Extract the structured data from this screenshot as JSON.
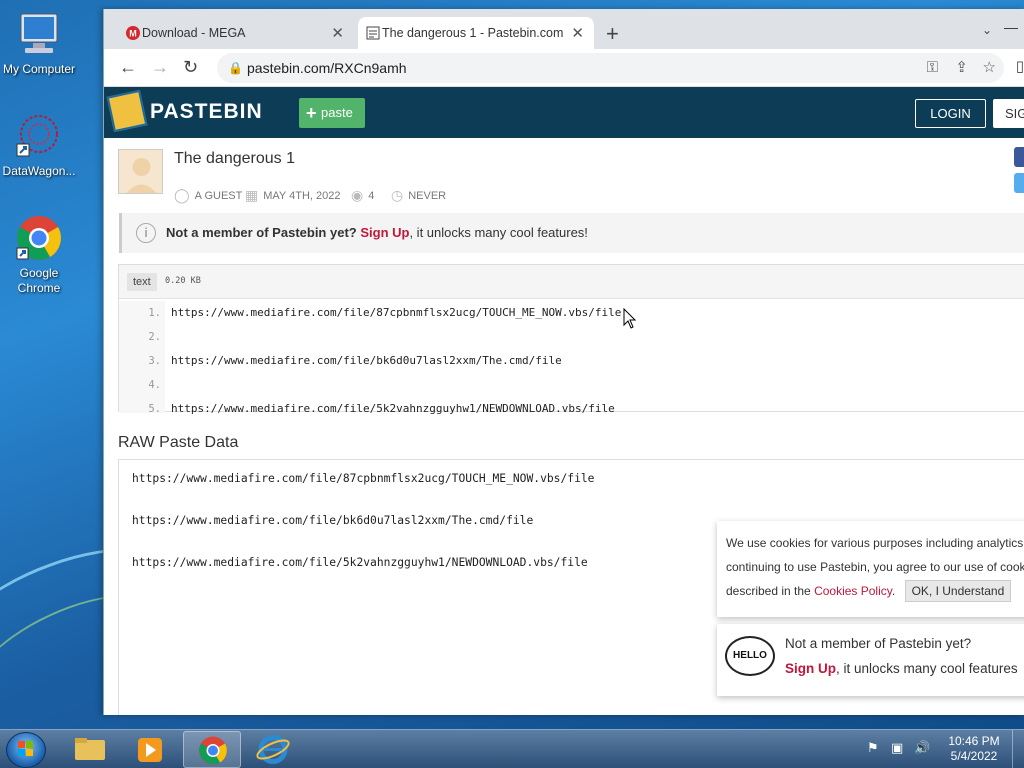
{
  "desktop": {
    "icons": [
      {
        "label": "My Computer"
      },
      {
        "label": "DataWagon..."
      },
      {
        "label": "Google Chrome"
      }
    ]
  },
  "browser": {
    "tabs": [
      {
        "title": "Download - MEGA"
      },
      {
        "title": "The dangerous 1 - Pastebin.com"
      }
    ],
    "url": "pastebin.com/RXCn9amh"
  },
  "pastebin": {
    "brand": "PASTEBIN",
    "paste_button": "paste",
    "login": "LOGIN",
    "signup": "SIG",
    "paste_title": "The dangerous 1",
    "meta": {
      "author": "A GUEST",
      "date": "MAY 4TH, 2022",
      "views": "4",
      "expires": "NEVER"
    },
    "notice": {
      "lead": "Not a member of Pastebin yet?",
      "link": "Sign Up",
      "tail": ", it unlocks many cool features!"
    },
    "code": {
      "lang": "text",
      "size": "0.20 KB",
      "lines": [
        {
          "n": "1.",
          "text": "https://www.mediafire.com/file/87cpbnmflsx2ucg/TOUCH_ME_NOW.vbs/file"
        },
        {
          "n": "2.",
          "text": ""
        },
        {
          "n": "3.",
          "text": "https://www.mediafire.com/file/bk6d0u7lasl2xxm/The.cmd/file"
        },
        {
          "n": "4.",
          "text": ""
        },
        {
          "n": "5.",
          "text": "https://www.mediafire.com/file/5k2vahnzgguyhw1/NEWDOWNLOAD.vbs/file"
        }
      ]
    },
    "raw_title": "RAW Paste Data",
    "raw_lines": [
      "https://www.mediafire.com/file/87cpbnmflsx2ucg/TOUCH_ME_NOW.vbs/file",
      "https://www.mediafire.com/file/bk6d0u7lasl2xxm/The.cmd/file",
      "https://www.mediafire.com/file/5k2vahnzgguyhw1/NEWDOWNLOAD.vbs/file"
    ],
    "cookie": {
      "line1": "We use cookies for various purposes including analytics.",
      "line2": "continuing to use Pastebin, you agree to our use of cook",
      "line3_pre": "described in the ",
      "line3_link": "Cookies Policy",
      "line3_post": ".",
      "ok": "OK, I Understand"
    },
    "hello": {
      "badge": "HELLO",
      "lead": "Not a member of Pastebin yet?",
      "link": "Sign Up",
      "tail": ", it unlocks many cool features"
    }
  },
  "taskbar": {
    "time": "10:46 PM",
    "date": "5/4/2022"
  },
  "colors": {
    "header_bg": "#0d3d56",
    "paste_green": "#52b36a",
    "link_red": "#c0173b"
  }
}
